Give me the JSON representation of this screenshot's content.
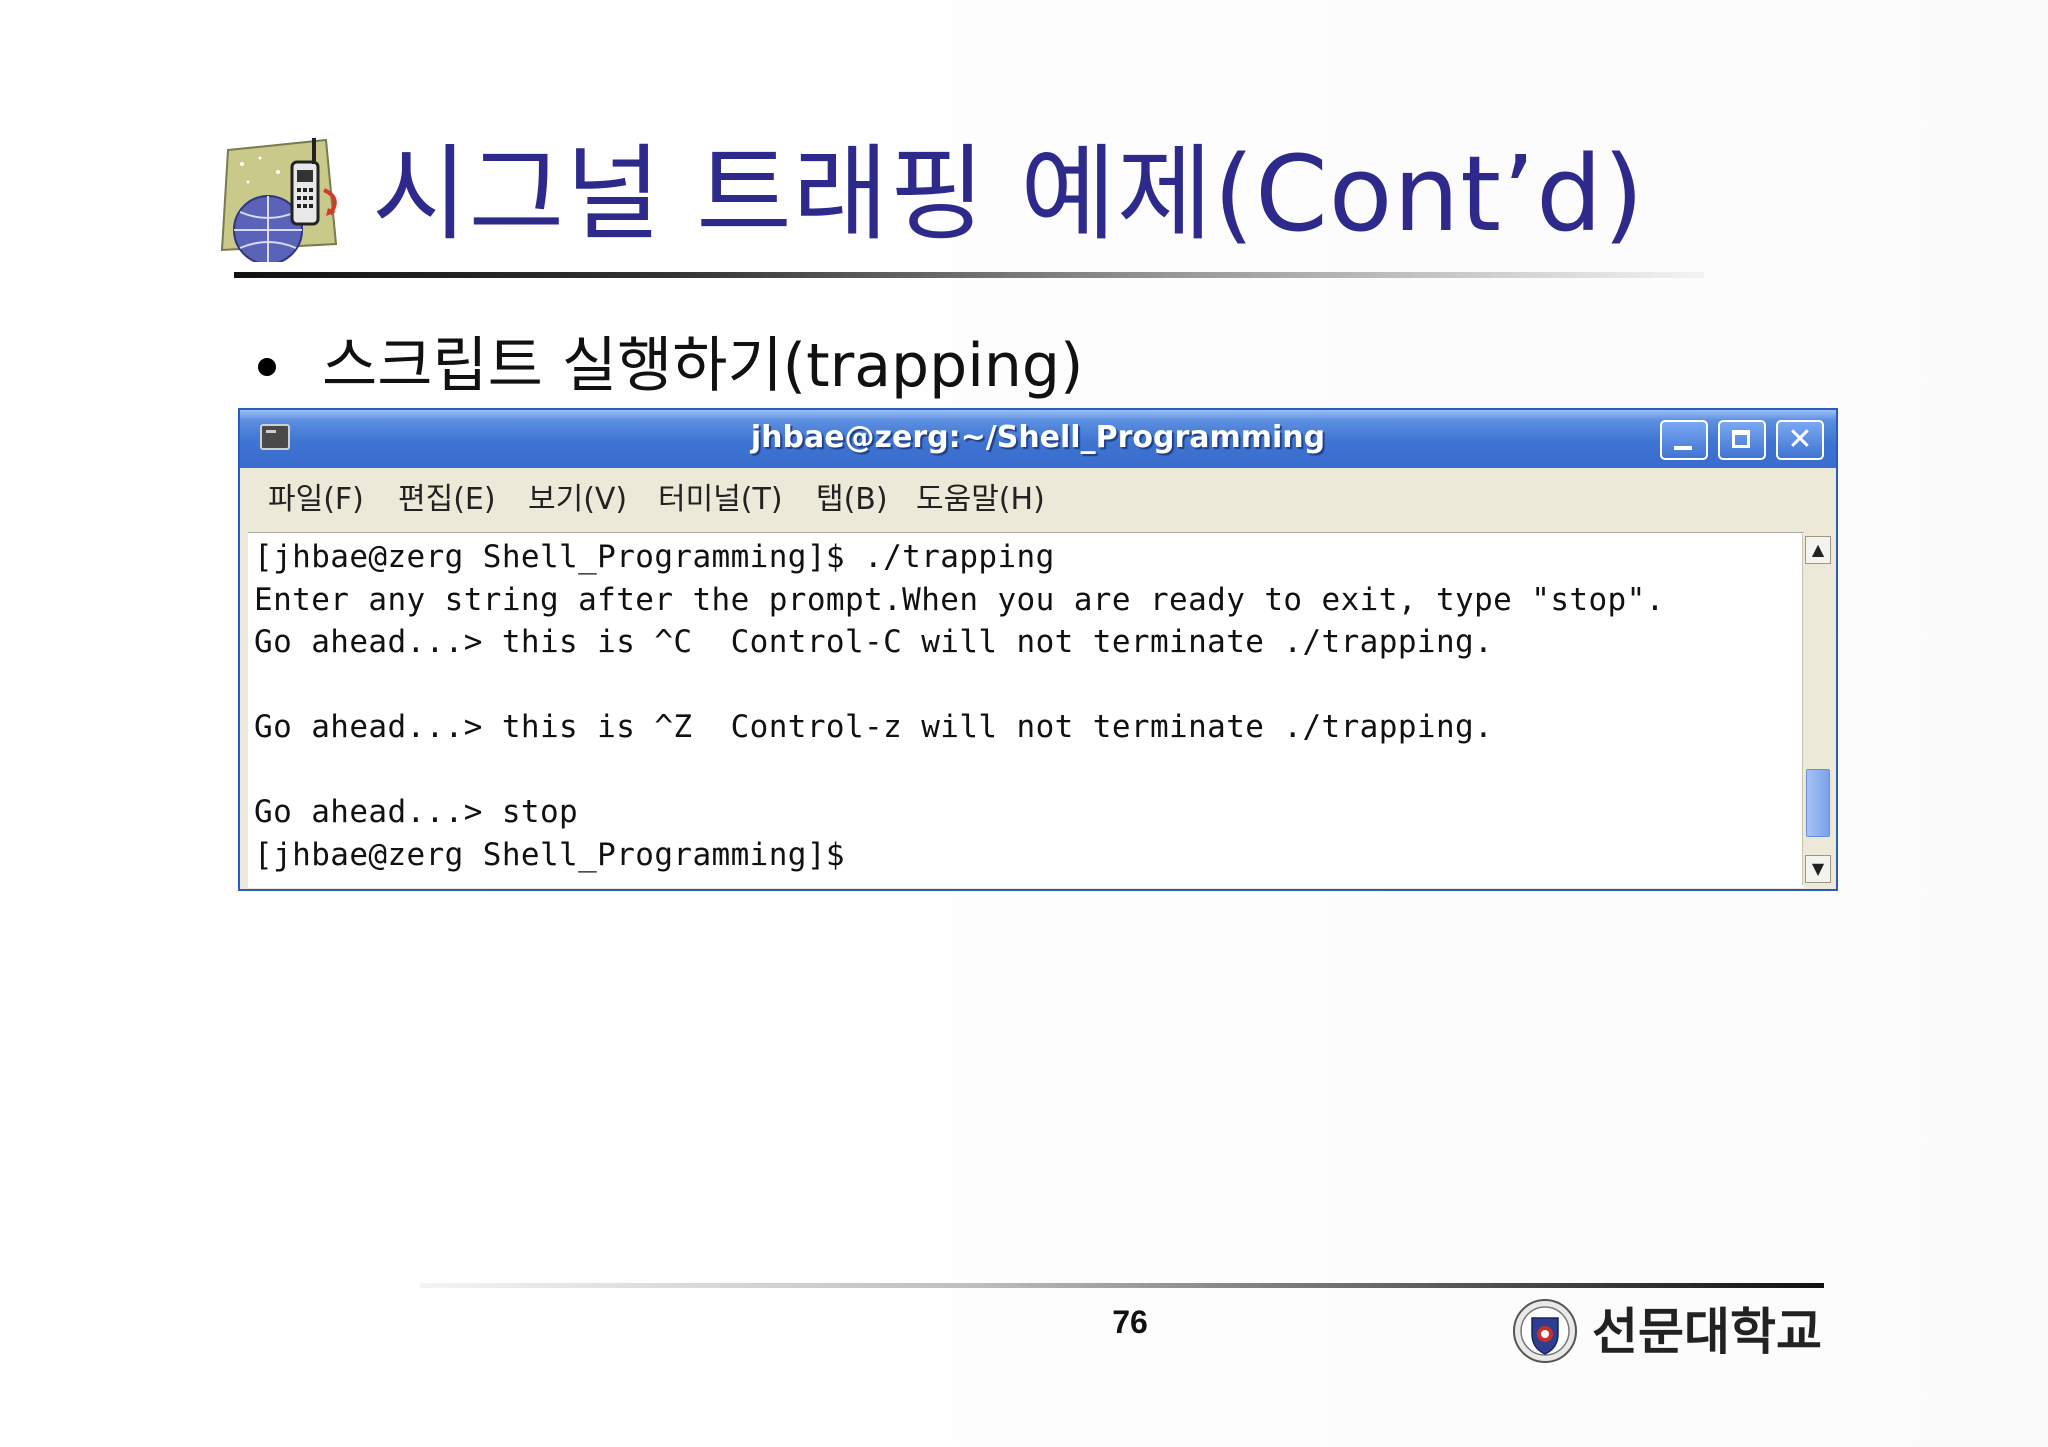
{
  "slide": {
    "title": "시그널 트래핑 예제(Cont’d)",
    "bullet": "스크립트 실행하기(trapping)",
    "page_number": "76",
    "university_name": "선문대학교"
  },
  "window": {
    "title": "jhbae@zerg:~/Shell_Programming",
    "icon": "terminal-icon",
    "controls": {
      "minimize": "minimize-icon",
      "maximize": "maximize-icon",
      "close_label": "✕"
    }
  },
  "menu": [
    "파일(F)",
    "편집(E)",
    "보기(V)",
    "터미널(T)",
    "탭(B)",
    "도움말(H)"
  ],
  "terminal": {
    "lines": [
      "[jhbae@zerg Shell_Programming]$ ./trapping",
      "Enter any string after the prompt.When you are ready to exit, type \"stop\".",
      "Go ahead...> this is ^C  Control-C will not terminate ./trapping.",
      "",
      "Go ahead...> this is ^Z  Control-z will not terminate ./trapping.",
      "",
      "Go ahead...> stop",
      "[jhbae@zerg Shell_Programming]$"
    ]
  },
  "colors": {
    "title": "#2e2a8c",
    "titlebar": "#3f74d2",
    "menubar": "#ece9d8"
  }
}
